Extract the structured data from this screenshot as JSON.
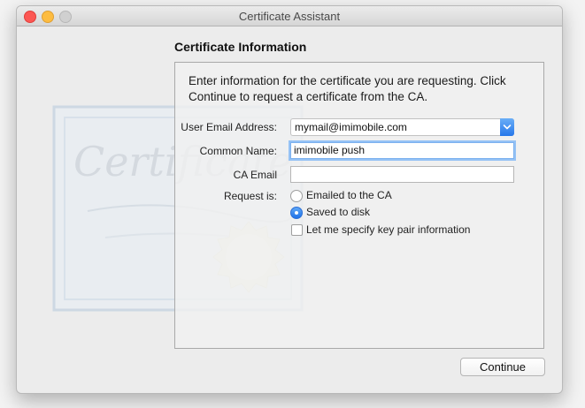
{
  "window": {
    "title": "Certificate Assistant"
  },
  "section_title": "Certificate Information",
  "intro": "Enter information for the certificate you are requesting. Click Continue to request a certificate from the CA.",
  "form": {
    "email_label": "User Email Address:",
    "email_value": "mymail@imimobile.com",
    "common_name_label": "Common Name:",
    "common_name_value": "imimobile push",
    "ca_email_label": "CA Email",
    "ca_email_value": "",
    "request_label": "Request is:",
    "options": [
      {
        "label": "Emailed to the CA",
        "selected": false
      },
      {
        "label": "Saved to disk",
        "selected": true
      }
    ],
    "key_pair_label": "Let me specify key pair information",
    "key_pair_checked": false
  },
  "continue_label": "Continue",
  "colors": {
    "accent": "#2677ea",
    "focus_ring": "#95c2f5"
  }
}
